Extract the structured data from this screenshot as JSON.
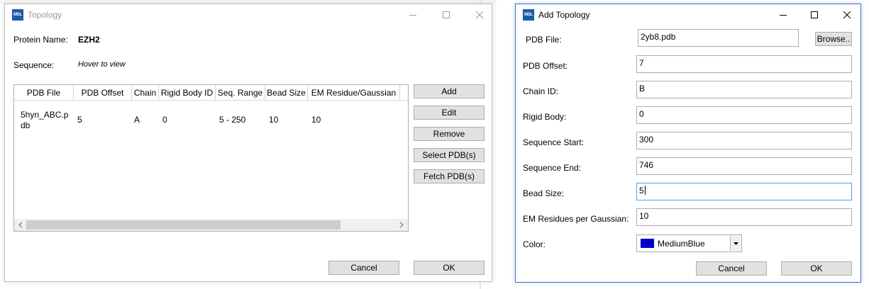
{
  "topology_window": {
    "title": "Topology",
    "app_icon_text": "MSL",
    "protein_name_label": "Protein Name:",
    "protein_name": "EZH2",
    "sequence_label": "Sequence:",
    "sequence_value": "Hover to view",
    "table": {
      "columns": [
        "PDB File",
        "PDB Offset",
        "Chain",
        "Rigid Body ID",
        "Seq. Range",
        "Bead Size",
        "EM Residue/Gaussian"
      ],
      "rows": [
        {
          "pdb_file": "5hyn_ABC.pdb",
          "pdb_offset": "5",
          "chain": "A",
          "rigid_body_id": "0",
          "seq_range": "5 - 250",
          "bead_size": "10",
          "em_residue": "10"
        }
      ]
    },
    "buttons": {
      "add": "Add",
      "edit": "Edit",
      "remove": "Remove",
      "select_pdbs": "Select PDB(s)",
      "fetch_pdbs": "Fetch PDB(s)",
      "cancel": "Cancel",
      "ok": "OK"
    }
  },
  "add_topology_window": {
    "title": "Add Topology",
    "app_icon_text": "MSL",
    "fields": {
      "pdb_file": {
        "label": "PDB File:",
        "value": "2yb8.pdb"
      },
      "pdb_offset": {
        "label": "PDB Offset:",
        "value": "7"
      },
      "chain_id": {
        "label": "Chain ID:",
        "value": "B"
      },
      "rigid_body": {
        "label": "Rigid Body:",
        "value": "0"
      },
      "sequence_start": {
        "label": "Sequence Start:",
        "value": "300"
      },
      "sequence_end": {
        "label": "Sequence End:",
        "value": "746"
      },
      "bead_size": {
        "label": "Bead Size:",
        "value": "5"
      },
      "em_residues": {
        "label": "EM Residues per Gaussian:",
        "value": "10"
      },
      "color": {
        "label": "Color:",
        "value": "MediumBlue",
        "swatch": "#0000CD"
      }
    },
    "buttons": {
      "browse": "Browse..",
      "cancel": "Cancel",
      "ok": "OK"
    }
  },
  "colors": {
    "active_border": "#2B79D6",
    "button_face": "#E1E1E1",
    "focus_border": "#569DE5",
    "icon_blue": "#1E5AA8"
  }
}
